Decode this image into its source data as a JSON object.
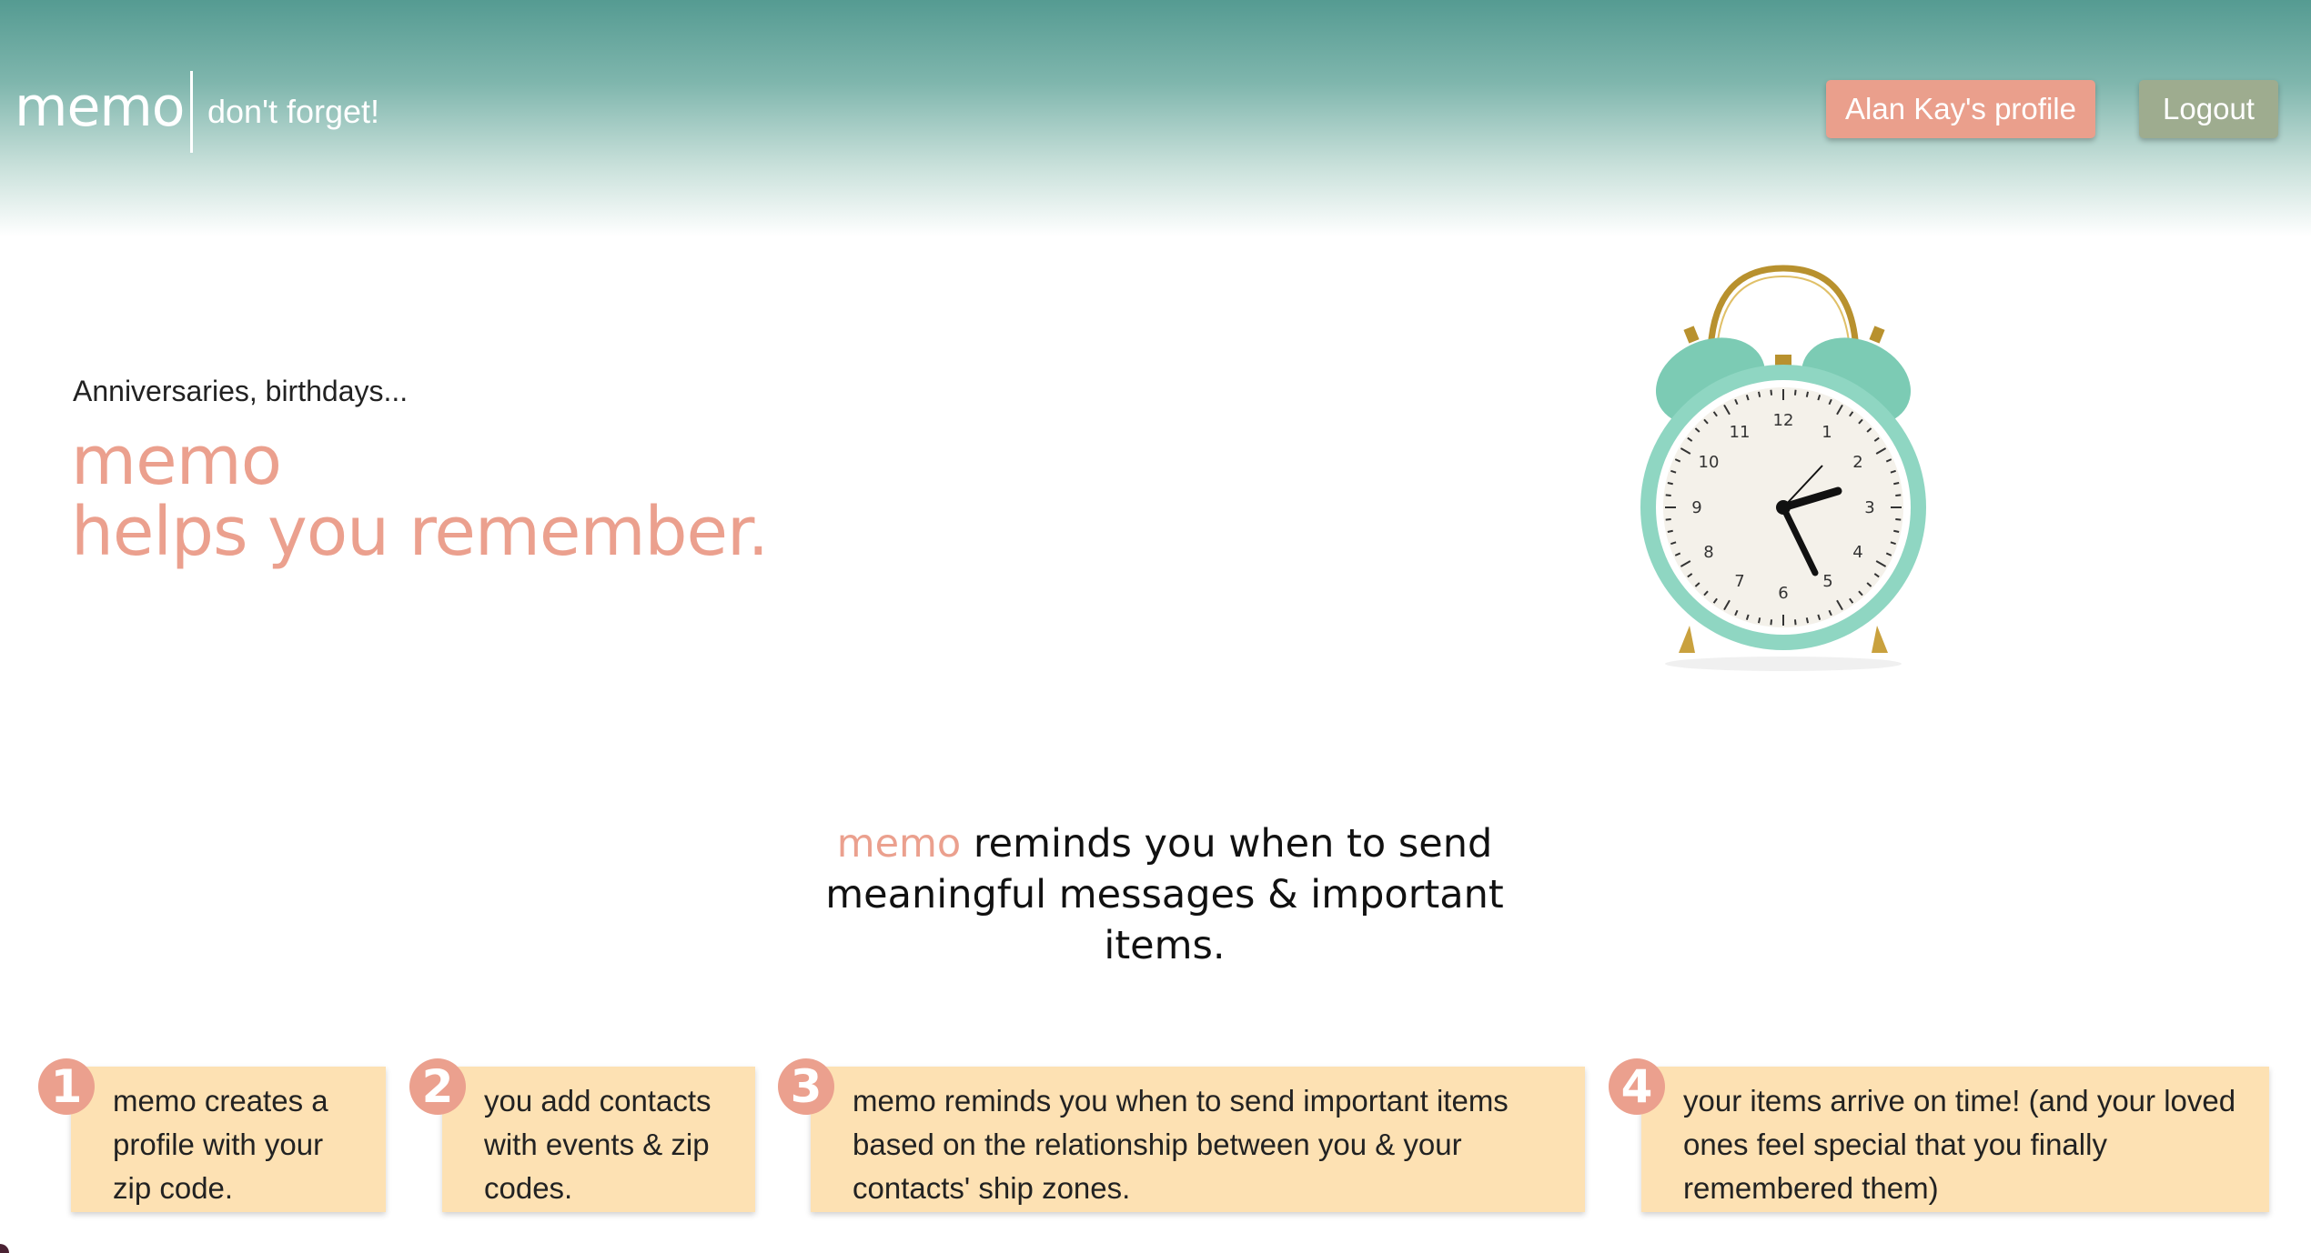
{
  "header": {
    "logo": "memo",
    "tagline": "don't forget!",
    "profile_button": "Alan Kay's profile",
    "logout_button": "Logout"
  },
  "hero": {
    "kicker": "Anniversaries, birthdays...",
    "title_line1": "memo",
    "title_line2": "helps you remember.",
    "image": "alarm-clock-illustration"
  },
  "mission": {
    "accent": "memo",
    "text": " reminds you when to send meaningful messages & important items."
  },
  "steps": [
    {
      "num": "1",
      "text": "memo creates a profile with your zip code."
    },
    {
      "num": "2",
      "text": "you add contacts with events & zip codes."
    },
    {
      "num": "3",
      "text": "memo reminds you when to send important items based on the relationship between you & your contacts' ship zones."
    },
    {
      "num": "4",
      "text": "your items arrive on time! (and your loved ones feel special that you finally remembered them)"
    }
  ],
  "colors": {
    "accent": "#eba08e",
    "header_teal": "#559b92",
    "step_bg": "#fde1b3",
    "logout_bg": "#9eac8f"
  }
}
